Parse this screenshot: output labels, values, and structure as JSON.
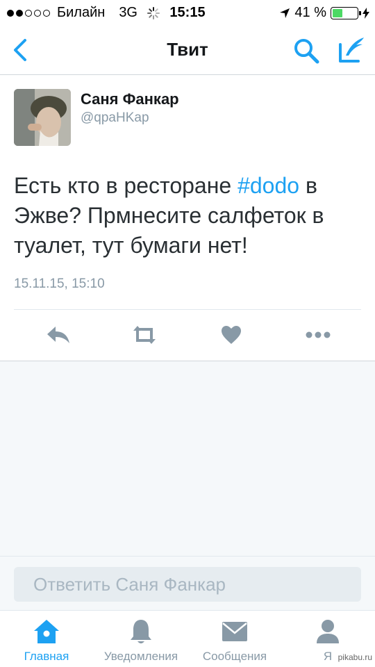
{
  "status_bar": {
    "carrier": "Билайн",
    "network": "3G",
    "time": "15:15",
    "battery": "41 %",
    "battery_level": 0.41
  },
  "nav": {
    "title": "Твит",
    "back_icon": "chevron-left-icon",
    "search_icon": "search-icon",
    "compose_icon": "compose-icon"
  },
  "tweet": {
    "author_name": "Саня Фанкар",
    "author_handle": "@qpaHKap",
    "text_before": "Есть кто в ресторане ",
    "hashtag": "#dodo",
    "text_after": " в Эжве? Прмнесите салфеток в туалет, тут бумаги нет!",
    "date": "15.11.15, 15:10"
  },
  "actions": [
    {
      "name": "reply-icon"
    },
    {
      "name": "retweet-icon"
    },
    {
      "name": "like-icon"
    },
    {
      "name": "more-icon"
    }
  ],
  "reply": {
    "placeholder": "Ответить Саня Фанкар"
  },
  "tabs": [
    {
      "label": "Главная",
      "icon": "home-icon",
      "active": true
    },
    {
      "label": "Уведомления",
      "icon": "bell-icon",
      "active": false
    },
    {
      "label": "Сообщения",
      "icon": "envelope-icon",
      "active": false
    },
    {
      "label": "Я",
      "icon": "person-icon",
      "active": false
    }
  ],
  "watermark": "pikabu.ru",
  "colors": {
    "accent": "#1da1f2",
    "icon_gray": "#8899a6",
    "battery_green": "#4cd964"
  }
}
